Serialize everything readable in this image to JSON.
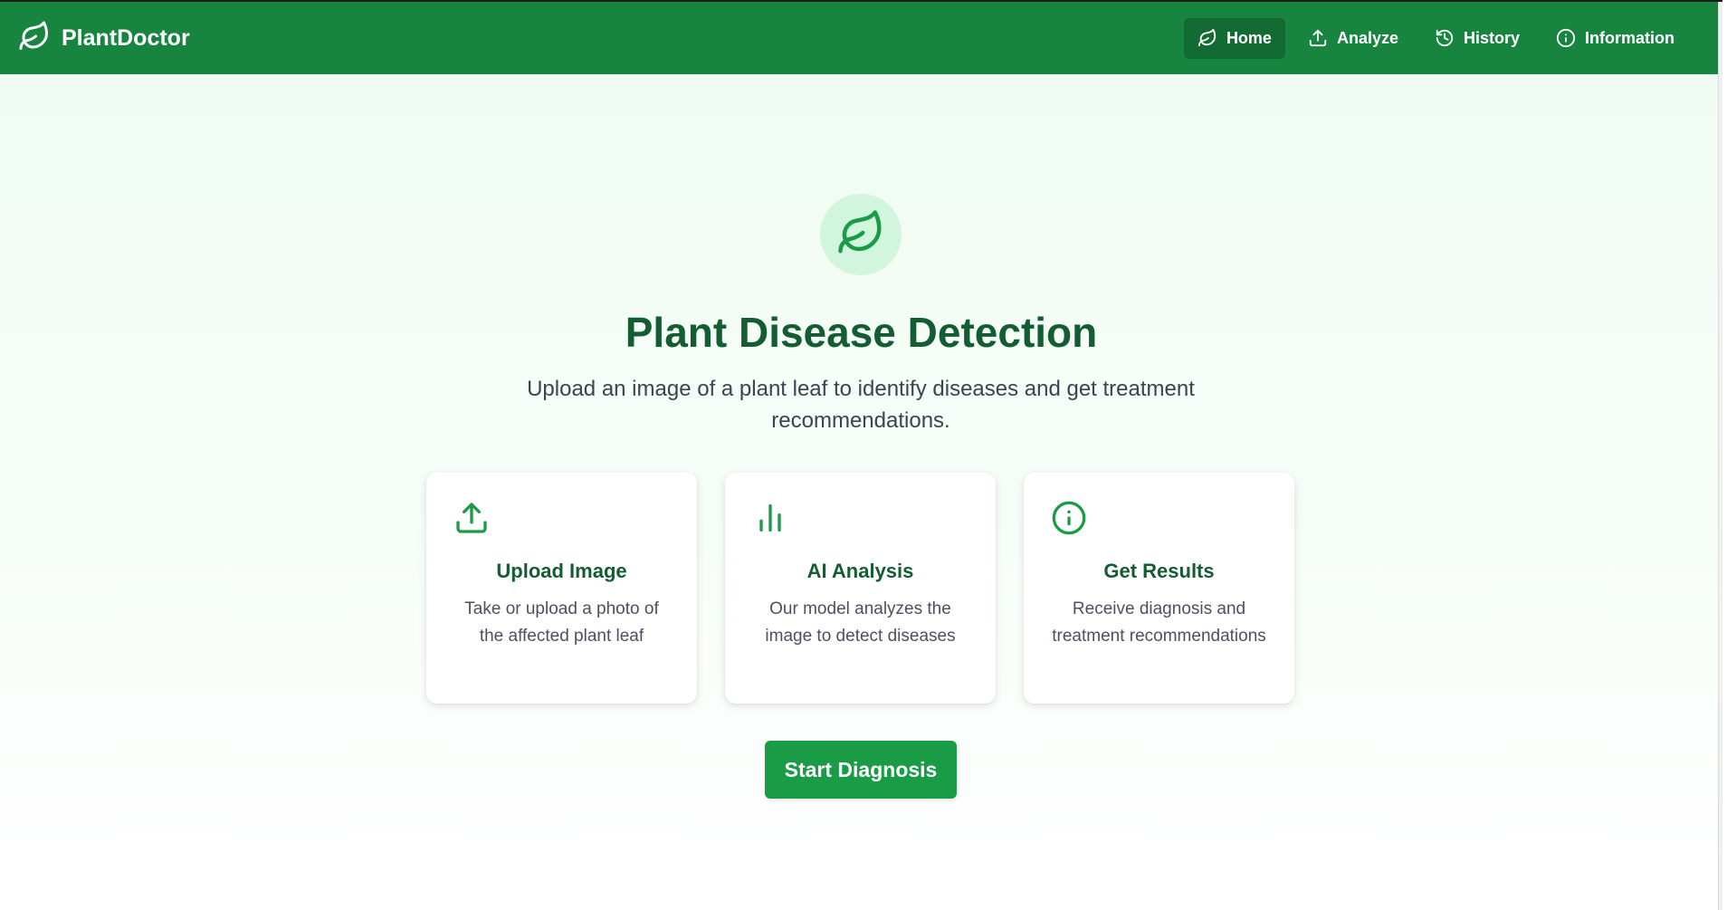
{
  "brand": {
    "name": "PlantDoctor",
    "icon": "leaf-icon"
  },
  "nav": {
    "items": [
      {
        "label": "Home",
        "icon": "leaf-icon",
        "active": true
      },
      {
        "label": "Analyze",
        "icon": "upload-icon",
        "active": false
      },
      {
        "label": "History",
        "icon": "history-icon",
        "active": false
      },
      {
        "label": "Information",
        "icon": "info-icon",
        "active": false
      }
    ]
  },
  "hero": {
    "icon": "leaf-icon",
    "title": "Plant Disease Detection",
    "subtitle": "Upload an image of a plant leaf to identify diseases and get treatment recommendations."
  },
  "features": [
    {
      "icon": "upload-icon",
      "title": "Upload Image",
      "description": "Take or upload a photo of the affected plant leaf"
    },
    {
      "icon": "bar-chart-icon",
      "title": "AI Analysis",
      "description": "Our model analyzes the image to detect diseases"
    },
    {
      "icon": "info-icon",
      "title": "Get Results",
      "description": "Receive diagnosis and treatment recommendations"
    }
  ],
  "cta": {
    "label": "Start Diagnosis"
  },
  "colors": {
    "navbar": "#178540",
    "nav_active": "#126b33",
    "heading": "#145c31",
    "accent": "#1a9b46",
    "badge_bg": "#d2f5dd"
  }
}
